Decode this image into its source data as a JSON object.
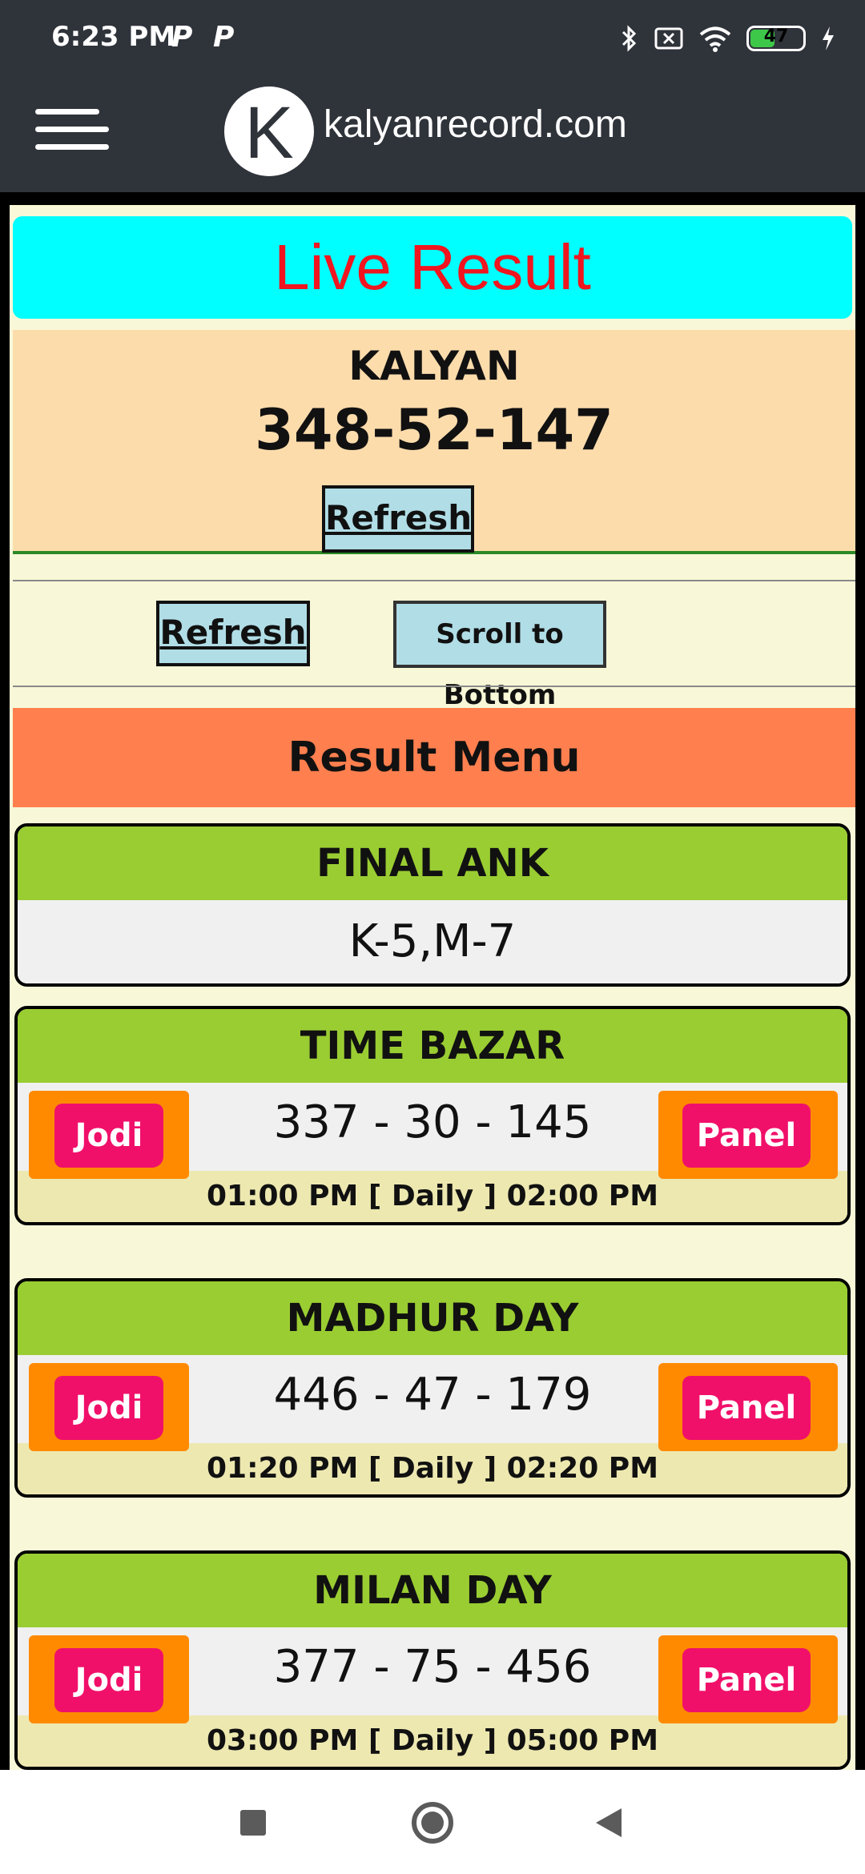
{
  "status_bar": {
    "time": "6:23 PM",
    "notification_icons": [
      "P",
      "P"
    ],
    "battery_level": "47",
    "battery_fraction": 0.47
  },
  "header": {
    "logo_letter": "K",
    "site_name": "kalyanrecord.com"
  },
  "live": {
    "title": "Live Result",
    "market": "KALYAN",
    "result": "348-52-147",
    "refresh_label": "Refresh"
  },
  "controls": {
    "refresh_label": "Refresh",
    "scroll_label": "Scroll to Bottom"
  },
  "result_menu": {
    "title": "Result Menu"
  },
  "final_ank": {
    "title": "FINAL ANK",
    "value": "K-5,M-7"
  },
  "markets": [
    {
      "name": "TIME BAZAR",
      "result": "337 - 30 - 145",
      "jodi_label": "Jodi",
      "panel_label": "Panel",
      "time": "01:00 PM [ Daily ] 02:00 PM"
    },
    {
      "name": "MADHUR DAY",
      "result": "446 - 47 - 179",
      "jodi_label": "Jodi",
      "panel_label": "Panel",
      "time": "01:20 PM [ Daily ] 02:20 PM"
    },
    {
      "name": "MILAN DAY",
      "result": "377 - 75 - 456",
      "jodi_label": "Jodi",
      "panel_label": "Panel",
      "time": "03:00 PM [ Daily ] 05:00 PM"
    }
  ],
  "colors": {
    "header_bg": "#2f333a",
    "live_bg": "#00ffff",
    "live_title": "#f0151e",
    "kalyan_bg": "#fddcac",
    "result_menu_bg": "#ff7f4f",
    "card_head_bg": "#9acd32",
    "side_btn_bg": "#ff8a00",
    "pill_bg": "#f0106a"
  }
}
